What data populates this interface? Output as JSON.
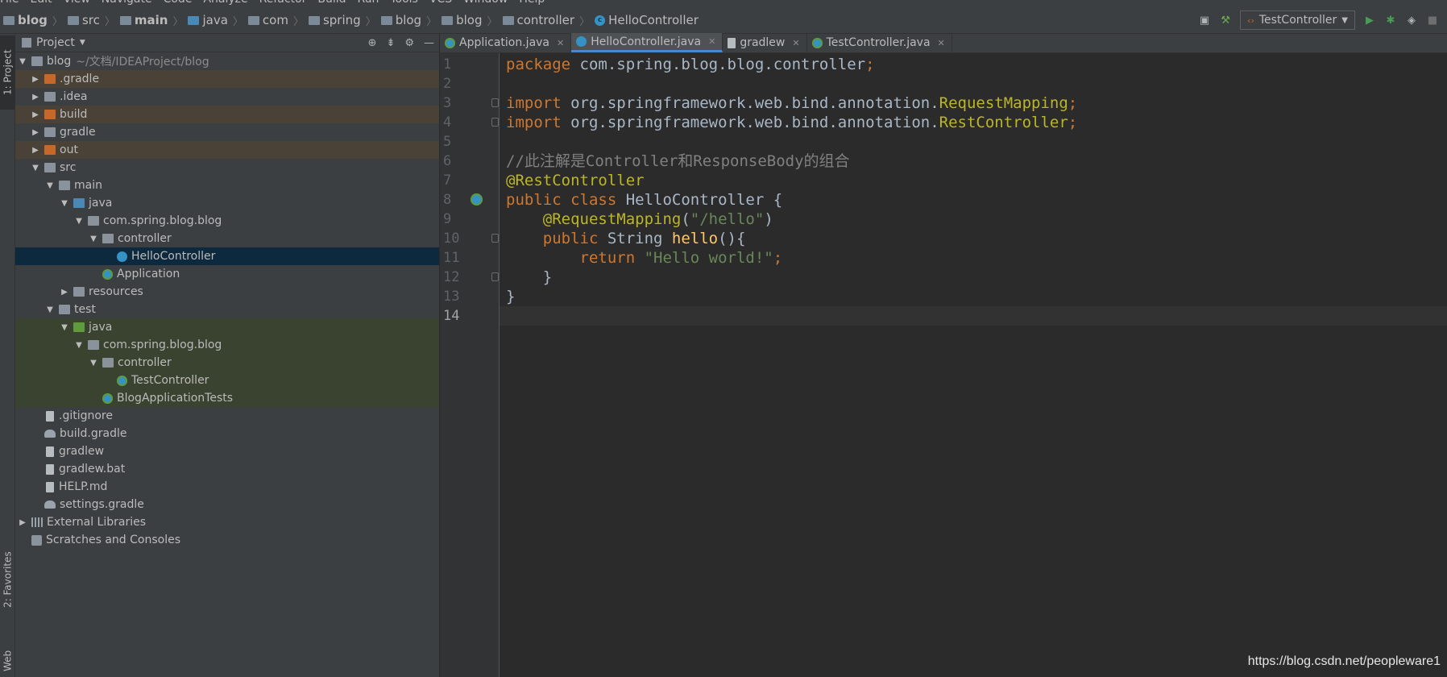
{
  "menu": [
    "File",
    "Edit",
    "View",
    "Navigate",
    "Code",
    "Analyze",
    "Refactor",
    "Build",
    "Run",
    "Tools",
    "VCS",
    "Window",
    "Help"
  ],
  "breadcrumbs": [
    "blog",
    "src",
    "main",
    "java",
    "com",
    "spring",
    "blog",
    "blog",
    "controller",
    "HelloController"
  ],
  "run_config": "TestController",
  "toolstrip": {
    "project_tab": "1: Project",
    "favorites_tab": "2: Favorites",
    "web_tab": "Web"
  },
  "project_panel": {
    "title": "Project",
    "root_name": "blog",
    "root_path": "~/文档/IDEAProject/blog",
    "items": [
      {
        "label": ".gradle"
      },
      {
        "label": ".idea"
      },
      {
        "label": "build"
      },
      {
        "label": "gradle"
      },
      {
        "label": "out"
      },
      {
        "label": "src"
      },
      {
        "label": "main"
      },
      {
        "label": "java"
      },
      {
        "label": "com.spring.blog.blog"
      },
      {
        "label": "controller"
      },
      {
        "label": "HelloController"
      },
      {
        "label": "Application"
      },
      {
        "label": "resources"
      },
      {
        "label": "test"
      },
      {
        "label": "java"
      },
      {
        "label": "com.spring.blog.blog"
      },
      {
        "label": "controller"
      },
      {
        "label": "TestController"
      },
      {
        "label": "BlogApplicationTests"
      },
      {
        "label": ".gitignore"
      },
      {
        "label": "build.gradle"
      },
      {
        "label": "gradlew"
      },
      {
        "label": "gradlew.bat"
      },
      {
        "label": "HELP.md"
      },
      {
        "label": "settings.gradle"
      },
      {
        "label": "External Libraries"
      },
      {
        "label": "Scratches and Consoles"
      }
    ]
  },
  "editor": {
    "tabs": [
      {
        "label": "Application.java"
      },
      {
        "label": "HelloController.java"
      },
      {
        "label": "gradlew"
      },
      {
        "label": "TestController.java"
      }
    ],
    "line_numbers": [
      "1",
      "2",
      "3",
      "4",
      "5",
      "6",
      "7",
      "8",
      "9",
      "10",
      "11",
      "12",
      "13",
      "14"
    ],
    "code": {
      "l1_kw": "package",
      "l1_pkg": " com.spring.blog.blog.controller",
      "l1_semi": ";",
      "l3_kw": "import",
      "l3_path": " org.springframework.web.bind.annotation.",
      "l3_cls": "RequestMapping",
      "l3_semi": ";",
      "l4_kw": "import",
      "l4_path": " org.springframework.web.bind.annotation.",
      "l4_cls": "RestController",
      "l4_semi": ";",
      "l6_cmt": "//此注解是Controller和ResponseBody的组合",
      "l7_ann": "@RestController",
      "l8_kw": "public class",
      "l8_name": " HelloController {",
      "l9_ann": "    @RequestMapping",
      "l9_p1": "(",
      "l9_str": "\"/hello\"",
      "l9_p2": ")",
      "l10_kw": "    public",
      "l10_type": " String ",
      "l10_fn": "hello",
      "l10_rest": "(){",
      "l11_kw": "        return",
      "l11_str": " \"Hello world!\"",
      "l11_semi": ";",
      "l12": "    }",
      "l13": "}"
    }
  },
  "watermark": "https://blog.csdn.net/peopleware1"
}
